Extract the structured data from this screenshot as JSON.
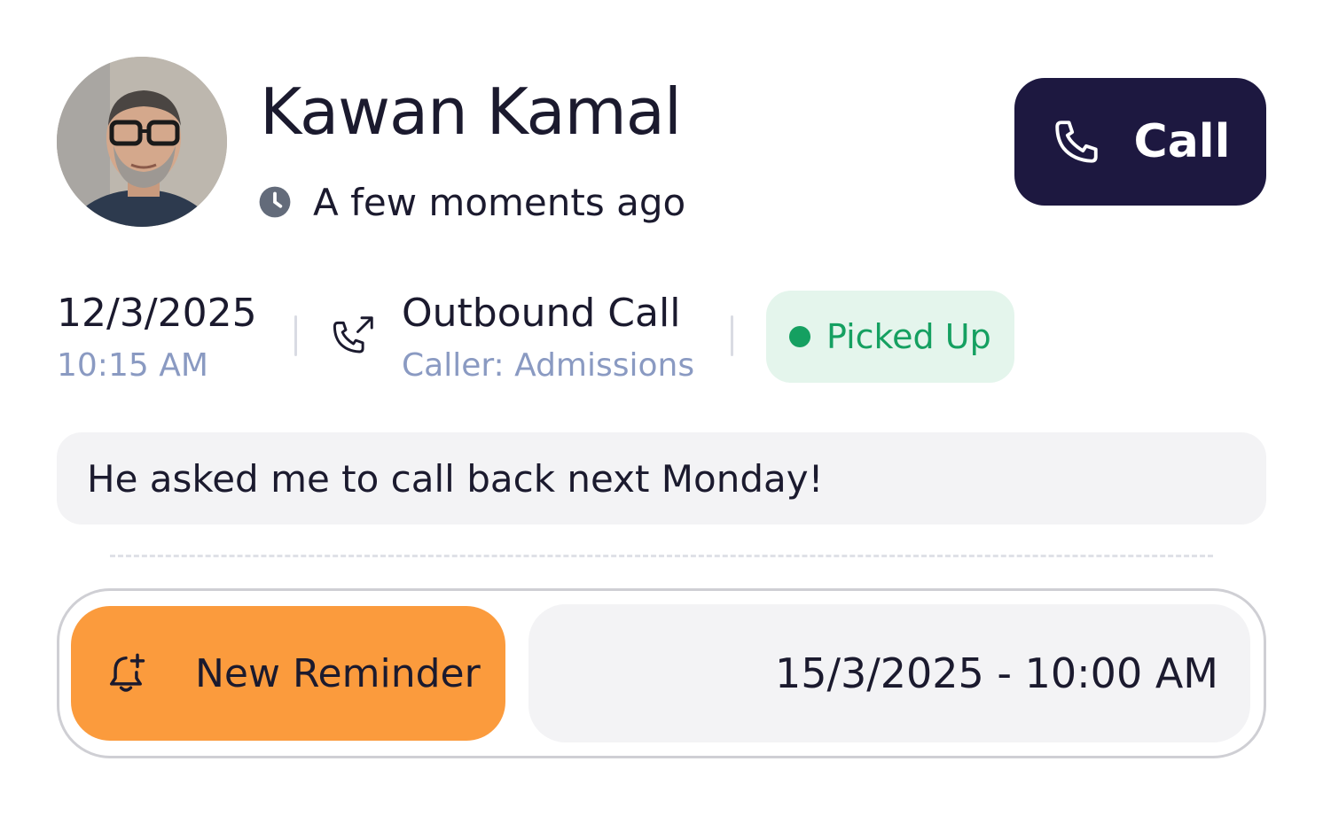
{
  "contact": {
    "name": "Kawan Kamal",
    "last_seen": "A few moments ago"
  },
  "actions": {
    "call_label": "Call"
  },
  "call_log": {
    "date": "12/3/2025",
    "time": "10:15 AM",
    "type": "Outbound Call",
    "caller": "Caller: Admissions",
    "status": "Picked Up"
  },
  "note": "He asked me to call back next Monday!",
  "reminder": {
    "button_label": "New Reminder",
    "datetime": "15/3/2025 - 10:00 AM"
  },
  "colors": {
    "call_button": "#1d1840",
    "status_green": "#15a061",
    "status_bg": "#e4f5ec",
    "reminder_orange": "#fb9b3d",
    "muted_blue": "#8a9ac2"
  },
  "icons": {
    "time": "clock-icon",
    "call": "phone-icon",
    "call_type": "outgoing-call-icon",
    "reminder": "bell-plus-icon"
  }
}
